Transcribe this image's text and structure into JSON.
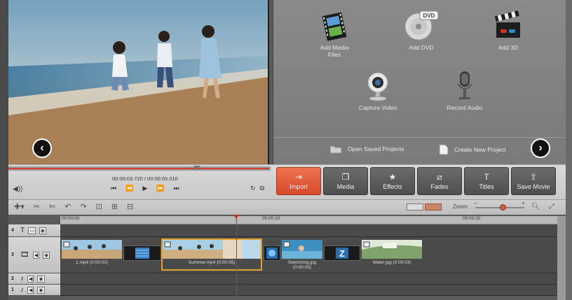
{
  "media_panel": {
    "tiles": [
      {
        "label": "Add Media\nFiles",
        "icon": "film-strip-icon"
      },
      {
        "label": "Add DVD",
        "icon": "dvd-icon"
      },
      {
        "label": "Add 3D",
        "icon": "clapperboard-3d-icon"
      },
      {
        "label": "Capture Video",
        "icon": "webcam-icon"
      },
      {
        "label": "Record Audio",
        "icon": "microphone-icon"
      }
    ],
    "dvd_badge": "DVD",
    "open_saved": "Open Saved Projects",
    "create_new": "Create New Project"
  },
  "player": {
    "timecode": "00:00:03.720 / 00:00:05.010",
    "progress": 0.72
  },
  "tabs": [
    {
      "label": "Import",
      "icon": "import-icon",
      "active": true
    },
    {
      "label": "Media",
      "icon": "media-icon",
      "active": false
    },
    {
      "label": "Effects",
      "icon": "star-icon",
      "active": false
    },
    {
      "label": "Fades",
      "icon": "fades-icon",
      "active": false
    },
    {
      "label": "Titles",
      "icon": "titles-icon",
      "active": false
    },
    {
      "label": "Save Movie",
      "icon": "save-movie-icon",
      "active": false
    }
  ],
  "timeline": {
    "zoom_label": "Zoom:",
    "zoom_level": 0.55,
    "ruler": [
      "00:00:00",
      "00:00:10",
      "00:00:20"
    ],
    "tracks": [
      {
        "num": "4",
        "type": "title"
      },
      {
        "num": "3",
        "type": "video"
      },
      {
        "num": "2",
        "type": "audio"
      },
      {
        "num": "1",
        "type": "audio"
      }
    ],
    "clips": [
      {
        "caption": "1.mp4 (0:00:03)"
      },
      {
        "caption": "Summer.mp4 (0:00:05)"
      },
      {
        "caption": "Swimming.jpg (0:00:03)"
      },
      {
        "caption": "Water.jpg (0:00:03)"
      }
    ]
  },
  "colors": {
    "accent": "#e2603a",
    "playhead": "#d8262a",
    "selection": "#e0a12a"
  }
}
